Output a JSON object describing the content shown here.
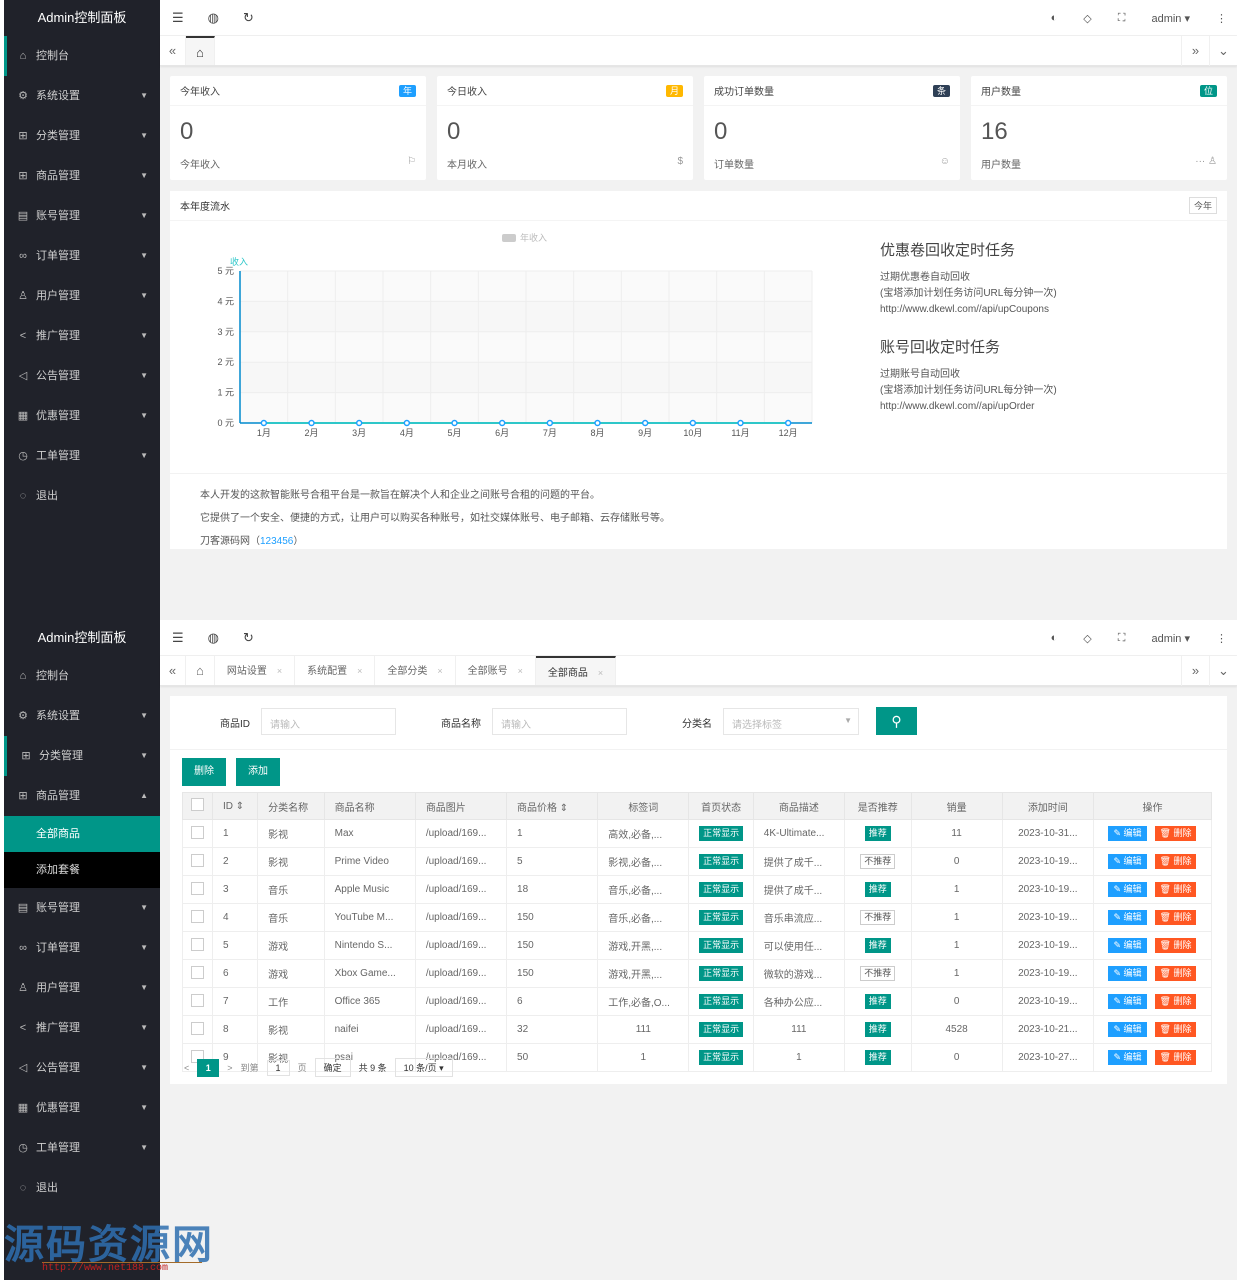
{
  "app_title": "Admin控制面板",
  "sidebar": {
    "items": [
      {
        "label": "控制台",
        "icon": "home-icon",
        "glyph": "⌂",
        "arrow": ""
      },
      {
        "label": "系统设置",
        "icon": "gear-icon",
        "glyph": "⚙",
        "arrow": "▼"
      },
      {
        "label": "分类管理",
        "icon": "apps-icon",
        "glyph": "⊞",
        "arrow": "▼"
      },
      {
        "label": "商品管理",
        "icon": "apps-icon",
        "glyph": "⊞",
        "arrow": "▼"
      },
      {
        "label": "账号管理",
        "icon": "list-icon",
        "glyph": "▤",
        "arrow": "▼"
      },
      {
        "label": "订单管理",
        "icon": "link-icon",
        "glyph": "∞",
        "arrow": "▼"
      },
      {
        "label": "用户管理",
        "icon": "user-icon",
        "glyph": "♙",
        "arrow": "▼"
      },
      {
        "label": "推广管理",
        "icon": "share-icon",
        "glyph": "<",
        "arrow": "▼"
      },
      {
        "label": "公告管理",
        "icon": "speaker-icon",
        "glyph": "◁",
        "arrow": "▼"
      },
      {
        "label": "优惠管理",
        "icon": "calendar-icon",
        "glyph": "▦",
        "arrow": "▼"
      },
      {
        "label": "工单管理",
        "icon": "clock-icon",
        "glyph": "◷",
        "arrow": "▼"
      },
      {
        "label": "退出",
        "icon": "shield-icon",
        "glyph": "◌",
        "arrow": ""
      }
    ],
    "product_submenu": [
      "全部商品",
      "添加套餐"
    ],
    "expanded_arrow": "▲"
  },
  "topbar": {
    "icons": {
      "menu": "☰",
      "globe": "◍",
      "refresh": "↻",
      "theme": "◐",
      "tag": "◇",
      "fullscreen": "⛶",
      "more": "⋮"
    },
    "user": "admin ▾"
  },
  "tabs_nav": {
    "left": "«",
    "right": "»",
    "down": "⌄",
    "home": "⌂",
    "close": "×"
  },
  "dashboard": {
    "cards": [
      {
        "title": "今年收入",
        "badge": "年",
        "badge_color": "#1e9fff",
        "value": "0",
        "footer": "今年收入",
        "footer_icon": "⚐"
      },
      {
        "title": "今日收入",
        "badge": "月",
        "badge_color": "#ffb800",
        "value": "0",
        "footer": "本月收入",
        "footer_icon": "$"
      },
      {
        "title": "成功订单数量",
        "badge": "条",
        "badge_color": "#2f4056",
        "value": "0",
        "footer": "订单数量",
        "footer_icon": "☺"
      },
      {
        "title": "用户数量",
        "badge": "位",
        "badge_color": "#009688",
        "value": "16",
        "footer": "用户数量",
        "footer_icon": "··· ♙"
      }
    ],
    "panel_title": "本年度流水",
    "year_button": "今年",
    "cron": [
      {
        "title": "优惠卷回收定时任务",
        "lines": [
          "过期优惠卷自动回收",
          "(宝塔添加计划任务访问URL每分钟一次)",
          "http://www.dkewl.com//api/upCoupons"
        ]
      },
      {
        "title": "账号回收定时任务",
        "lines": [
          "过期账号自动回收",
          "(宝塔添加计划任务访问URL每分钟一次)",
          "http://www.dkewl.com//api/upOrder"
        ]
      }
    ],
    "about": {
      "line1": "本人开发的这款智能账号合租平台是一款旨在解决个人和企业之间账号合租的问题的平台。",
      "line2": "它提供了一个安全、便捷的方式，让用户可以购买各种账号，如社交媒体账号、电子邮箱、云存储账号等。",
      "line3_prefix": "刀客源码网（",
      "line3_link": "123456",
      "line3_suffix": "）"
    }
  },
  "chart_data": {
    "type": "line",
    "title": "",
    "legend": [
      "年收入"
    ],
    "legend_position": "top-center",
    "ylabel": "收入",
    "xlabel": "",
    "categories": [
      "1月",
      "2月",
      "3月",
      "4月",
      "5月",
      "6月",
      "7月",
      "8月",
      "9月",
      "10月",
      "11月",
      "12月"
    ],
    "series": [
      {
        "name": "年收入",
        "values": [
          0,
          0,
          0,
          0,
          0,
          0,
          0,
          0,
          0,
          0,
          0,
          0
        ]
      }
    ],
    "ylim": [
      0,
      5
    ],
    "yticks": [
      "0 元",
      "1 元",
      "2 元",
      "3 元",
      "4 元",
      "5 元"
    ],
    "grid": true,
    "color": "#2ec7c9"
  },
  "products_page": {
    "tabs": [
      "网站设置",
      "系统配置",
      "全部分类",
      "全部账号",
      "全部商品"
    ],
    "active_tab": 4,
    "filter": {
      "id_label": "商品ID",
      "id_placeholder": "请输入",
      "name_label": "商品名称",
      "name_placeholder": "请输入",
      "cat_label": "分类名",
      "cat_placeholder": "请选择标签",
      "search_icon": "🔍"
    },
    "buttons": {
      "delete": "删除",
      "add": "添加"
    },
    "columns": [
      "ID ⇕",
      "分类名称",
      "商品名称",
      "商品图片",
      "商品价格 ⇕",
      "标签词",
      "首页状态",
      "商品描述",
      "是否推荐",
      "销量",
      "添加时间",
      "操作"
    ],
    "rows": [
      {
        "id": "1",
        "cat": "影视",
        "name": "Max",
        "img": "/upload/169...",
        "price": "1",
        "tags": "高效,必备,...",
        "status": "正常显示",
        "desc": "4K-Ultimate...",
        "rec": "推荐",
        "rec_on": true,
        "sales": "11",
        "time": "2023-10-31..."
      },
      {
        "id": "2",
        "cat": "影视",
        "name": "Prime Video",
        "img": "/upload/169...",
        "price": "5",
        "tags": "影视,必备,...",
        "status": "正常显示",
        "desc": "提供了成千...",
        "rec": "不推荐",
        "rec_on": false,
        "sales": "0",
        "time": "2023-10-19..."
      },
      {
        "id": "3",
        "cat": "音乐",
        "name": "Apple Music",
        "img": "/upload/169...",
        "price": "18",
        "tags": "音乐,必备,...",
        "status": "正常显示",
        "desc": "提供了成千...",
        "rec": "推荐",
        "rec_on": true,
        "sales": "1",
        "time": "2023-10-19..."
      },
      {
        "id": "4",
        "cat": "音乐",
        "name": "YouTube M...",
        "img": "/upload/169...",
        "price": "150",
        "tags": "音乐,必备,...",
        "status": "正常显示",
        "desc": "音乐串流应...",
        "rec": "不推荐",
        "rec_on": false,
        "sales": "1",
        "time": "2023-10-19..."
      },
      {
        "id": "5",
        "cat": "游戏",
        "name": "Nintendo S...",
        "img": "/upload/169...",
        "price": "150",
        "tags": "游戏,开黑,...",
        "status": "正常显示",
        "desc": "可以使用任...",
        "rec": "推荐",
        "rec_on": true,
        "sales": "1",
        "time": "2023-10-19..."
      },
      {
        "id": "6",
        "cat": "游戏",
        "name": "Xbox Game...",
        "img": "/upload/169...",
        "price": "150",
        "tags": "游戏,开黑,...",
        "status": "正常显示",
        "desc": "微软的游戏...",
        "rec": "不推荐",
        "rec_on": false,
        "sales": "1",
        "time": "2023-10-19..."
      },
      {
        "id": "7",
        "cat": "工作",
        "name": "Office 365",
        "img": "/upload/169...",
        "price": "6",
        "tags": "工作,必备,O...",
        "status": "正常显示",
        "desc": "各种办公应...",
        "rec": "推荐",
        "rec_on": true,
        "sales": "0",
        "time": "2023-10-19..."
      },
      {
        "id": "8",
        "cat": "影视",
        "name": "naifei",
        "img": "/upload/169...",
        "price": "32",
        "tags": "111",
        "status": "正常显示",
        "desc": "111",
        "rec": "推荐",
        "rec_on": true,
        "sales": "4528",
        "time": "2023-10-21..."
      },
      {
        "id": "9",
        "cat": "影视",
        "name": "psai",
        "img": "/upload/169...",
        "price": "50",
        "tags": "1",
        "status": "正常显示",
        "desc": "1",
        "rec": "推荐",
        "rec_on": true,
        "sales": "0",
        "time": "2023-10-27..."
      }
    ],
    "row_actions": {
      "edit": "✎ 编辑",
      "delete": "🗑 删除"
    },
    "pagination": {
      "prev": "<",
      "current": "1",
      "next": ">",
      "goto_label": "到第",
      "goto_value": "1",
      "page_suffix": "页",
      "confirm": "确定",
      "total": "共 9 条",
      "page_size": "10 条/页 ▾"
    }
  },
  "watermark": {
    "text": "源码资源网",
    "url": "http://www.net188.com"
  }
}
